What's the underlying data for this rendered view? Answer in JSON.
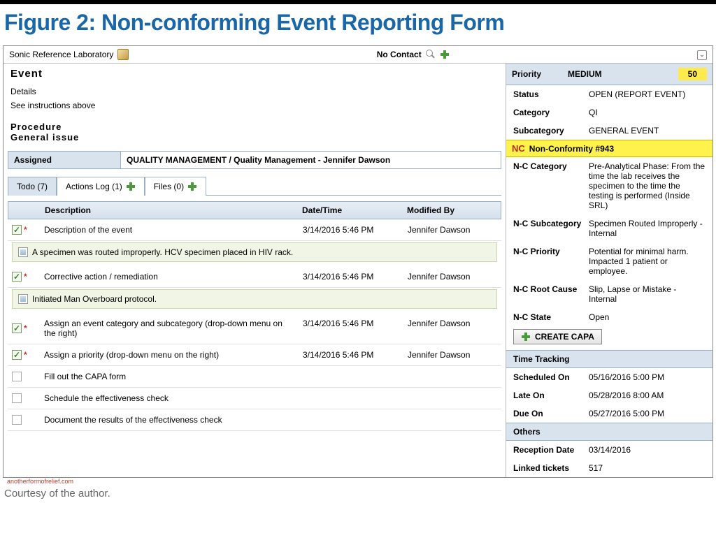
{
  "figure_title": "Figure 2: Non-conforming Event Reporting Form",
  "header": {
    "org": "Sonic Reference Laboratory",
    "contact": "No Contact"
  },
  "event": {
    "heading": "Event",
    "details_label": "Details",
    "details_text": "See instructions above",
    "procedure_label": "Procedure",
    "procedure_value": "General issue"
  },
  "assigned": {
    "label": "Assigned",
    "value": "QUALITY MANAGEMENT / Quality Management - Jennifer Dawson"
  },
  "tabs": {
    "todo": "Todo (7)",
    "actions": "Actions Log (1)",
    "files": "Files (0)"
  },
  "table": {
    "h_desc": "Description",
    "h_date": "Date/Time",
    "h_mod": "Modified By",
    "rows": [
      {
        "checked": true,
        "req": true,
        "desc": "Description of the event",
        "date": "3/14/2016 5:46 PM",
        "mod": "Jennifer Dawson"
      },
      {
        "checked": true,
        "req": true,
        "desc": "Corrective action / remediation",
        "date": "3/14/2016 5:46 PM",
        "mod": "Jennifer Dawson"
      },
      {
        "checked": true,
        "req": true,
        "desc": "Assign an event category and subcategory (drop-down menu on the right)",
        "date": "3/14/2016 5:46 PM",
        "mod": "Jennifer Dawson"
      },
      {
        "checked": true,
        "req": true,
        "desc": "Assign a priority (drop-down menu on the right)",
        "date": "3/14/2016 5:46 PM",
        "mod": "Jennifer Dawson"
      },
      {
        "checked": false,
        "req": false,
        "desc": "Fill out the CAPA form",
        "date": "",
        "mod": ""
      },
      {
        "checked": false,
        "req": false,
        "desc": "Schedule the effectiveness check",
        "date": "",
        "mod": ""
      },
      {
        "checked": false,
        "req": false,
        "desc": "Document the results of the effectiveness check",
        "date": "",
        "mod": ""
      }
    ],
    "notes": {
      "0": "A specimen was routed improperly. HCV specimen placed in HIV rack.",
      "1": "Initiated Man Overboard protocol."
    }
  },
  "right": {
    "priority_label": "Priority",
    "priority_level": "MEDIUM",
    "priority_num": "50",
    "status_label": "Status",
    "status_value": "OPEN (REPORT EVENT)",
    "category_label": "Category",
    "category_value": "QI",
    "subcat_label": "Subcategory",
    "subcat_value": "GENERAL EVENT",
    "nc_label": "Non-Conformity #943",
    "nc_cat_label": "N-C Category",
    "nc_cat_value": "Pre-Analytical Phase: From the time the lab receives the specimen to the time the testing is performed (Inside SRL)",
    "nc_subcat_label": "N-C Subcategory",
    "nc_subcat_value": "Specimen Routed Improperly - Internal",
    "nc_priority_label": "N-C Priority",
    "nc_priority_value": "Potential for minimal harm. Impacted 1 patient or employee.",
    "nc_root_label": "N-C Root Cause",
    "nc_root_value": "Slip, Lapse or Mistake - Internal",
    "nc_state_label": "N-C State",
    "nc_state_value": "Open",
    "create_capa": "CREATE CAPA",
    "tt_head": "Time Tracking",
    "sched_label": "Scheduled On",
    "sched_value": "05/16/2016 5:00 PM",
    "late_label": "Late On",
    "late_value": "05/28/2016 8:00 AM",
    "due_label": "Due On",
    "due_value": "05/27/2016 5:00 PM",
    "others_head": "Others",
    "recep_label": "Reception Date",
    "recep_value": "03/14/2016",
    "linked_label": "Linked tickets",
    "linked_value": "517"
  },
  "footer": {
    "watermark": "anotherformofrelief.com",
    "credit": "Courtesy of the author."
  }
}
